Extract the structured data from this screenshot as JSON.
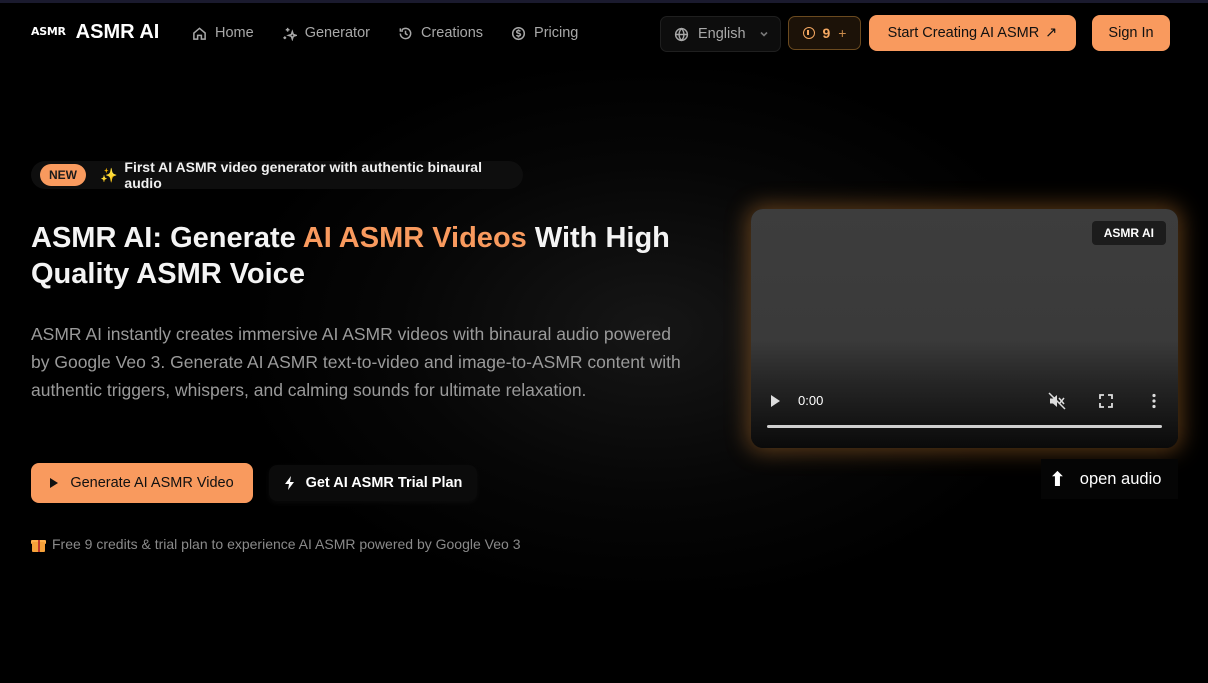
{
  "nav": {
    "logo_mark": "ASMR",
    "logo_text": "ASMR AI",
    "links": [
      {
        "label": "Home",
        "icon": "home-icon"
      },
      {
        "label": "Generator",
        "icon": "sparkles-icon"
      },
      {
        "label": "Creations",
        "icon": "history-icon"
      },
      {
        "label": "Pricing",
        "icon": "dollar-circle-icon"
      }
    ],
    "language": "English",
    "credits": "9",
    "credits_plus": "+",
    "start_label": "Start Creating AI ASMR",
    "start_arrow": "↗",
    "signin_label": "Sign In"
  },
  "hero": {
    "badge": "NEW",
    "badge_icon": "✨",
    "badge_text": "First AI ASMR video generator with authentic binaural audio",
    "headline_pre": "ASMR AI: Generate ",
    "headline_accent": "AI ASMR Videos",
    "headline_post": " With High Quality ASMR Voice",
    "description": "ASMR AI instantly creates immersive AI ASMR videos with binaural audio powered by Google Veo 3. Generate AI ASMR text-to-video and image-to-ASMR content with authentic triggers, whispers, and calming sounds for ultimate relaxation.",
    "primary_cta": "Generate AI ASMR Video",
    "secondary_cta": "Get AI ASMR Trial Plan",
    "free_note": "Free 9 credits & trial plan to experience AI ASMR powered by Google Veo 3"
  },
  "video": {
    "tag": "ASMR AI",
    "time": "0:00",
    "progress": 0
  },
  "audio_hint": {
    "arrow": "⬆",
    "label": "open audio"
  },
  "colors": {
    "accent": "#f99a5e",
    "background": "#000000",
    "muted_text": "#9a9a9a"
  }
}
